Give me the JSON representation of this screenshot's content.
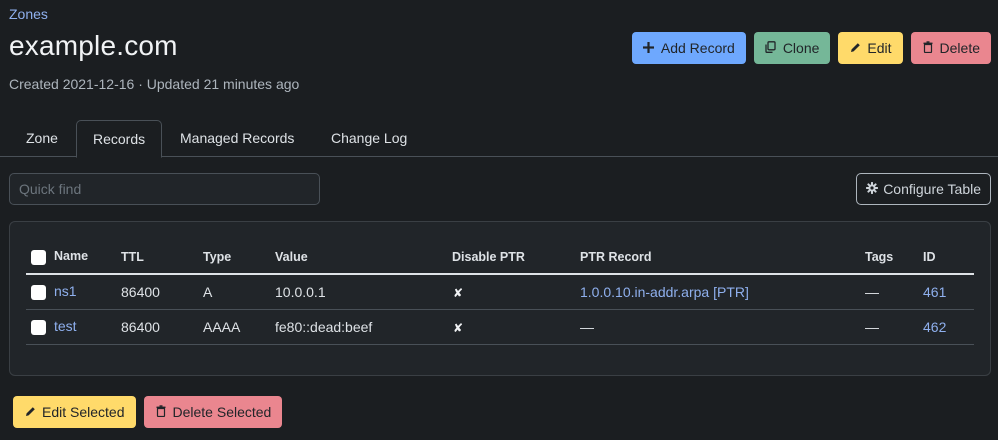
{
  "breadcrumb": {
    "zones_label": "Zones"
  },
  "header": {
    "title": "example.com",
    "subtitle": "Created 2021-12-16 · Updated 21 minutes ago"
  },
  "actions": {
    "add_record": "Add Record",
    "clone": "Clone",
    "edit": "Edit",
    "delete": "Delete"
  },
  "tabs": [
    {
      "label": "Zone",
      "active": false
    },
    {
      "label": "Records",
      "active": true
    },
    {
      "label": "Managed Records",
      "active": false
    },
    {
      "label": "Change Log",
      "active": false
    }
  ],
  "search": {
    "placeholder": "Quick find",
    "value": ""
  },
  "configure_table_label": "Configure Table",
  "table": {
    "columns": [
      "Name",
      "TTL",
      "Type",
      "Value",
      "Disable PTR",
      "PTR Record",
      "Tags",
      "ID"
    ],
    "rows": [
      {
        "name": "ns1",
        "ttl": "86400",
        "type": "A",
        "value": "10.0.0.1",
        "disable_ptr": "✘",
        "ptr_record": "1.0.0.10.in-addr.arpa [PTR]",
        "tags": "—",
        "id": "461"
      },
      {
        "name": "test",
        "ttl": "86400",
        "type": "AAAA",
        "value": "fe80::dead:beef",
        "disable_ptr": "✘",
        "ptr_record": "—",
        "tags": "—",
        "id": "462"
      }
    ]
  },
  "bulk_actions": {
    "edit_selected": "Edit Selected",
    "delete_selected": "Delete Selected"
  },
  "icons": {
    "add": "plus-icon",
    "clone": "copy-icon",
    "edit": "pencil-icon",
    "delete": "trash-icon",
    "configure": "gear-icon"
  },
  "colors": {
    "background": "#1b1e21",
    "link": "#8fb0ee",
    "primary": "#6ea8fe",
    "success": "#75b798",
    "warning": "#ffda6a",
    "danger": "#ea868f"
  }
}
